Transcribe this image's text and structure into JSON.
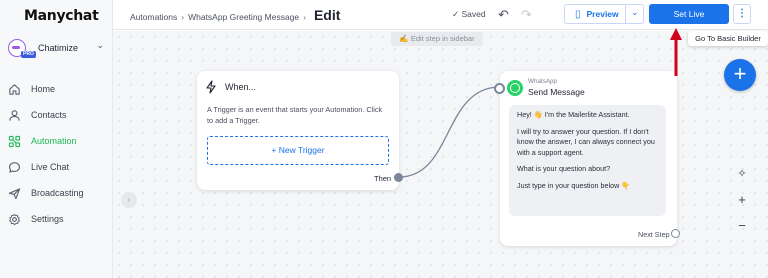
{
  "app": {
    "logo": "Manychat"
  },
  "account": {
    "name": "Chatimize",
    "badge": "PRO"
  },
  "sidebar": {
    "items": [
      {
        "label": "Home",
        "icon": "home-icon",
        "active": false
      },
      {
        "label": "Contacts",
        "icon": "contacts-icon",
        "active": false
      },
      {
        "label": "Automation",
        "icon": "automation-icon",
        "active": true
      },
      {
        "label": "Live Chat",
        "icon": "live-chat-icon",
        "active": false
      },
      {
        "label": "Broadcasting",
        "icon": "broadcasting-icon",
        "active": false
      },
      {
        "label": "Settings",
        "icon": "settings-icon",
        "active": false
      }
    ]
  },
  "header": {
    "breadcrumbs": [
      "Automations",
      "WhatsApp Greeting Message",
      "Edit"
    ],
    "saved_label": "Saved",
    "preview_label": "Preview",
    "set_live_label": "Set Live"
  },
  "canvas": {
    "edit_hint": "✍ Edit step in sidebar",
    "trigger_card": {
      "title": "When...",
      "description": "A Trigger is an event that starts your Automation. Click to add a Trigger.",
      "new_trigger_label": "+ New Trigger",
      "then_label": "Then"
    },
    "send_card": {
      "kicker": "WhatsApp",
      "title": "Send Message",
      "messages": [
        "Hey! 👋 I'm the Mailerlite Assistant.",
        "I will try to answer your question. If I don't know the answer, I can always connect you with a support agent.",
        "What is your question about?",
        "Just type in your question below 👇"
      ],
      "next_step_label": "Next Step"
    }
  },
  "tooltip": {
    "text": "Go To Basic Builder"
  },
  "colors": {
    "accent": "#1a73e8",
    "active_nav": "#1db954",
    "arrow": "#d0021b",
    "whatsapp": "#25d366"
  }
}
